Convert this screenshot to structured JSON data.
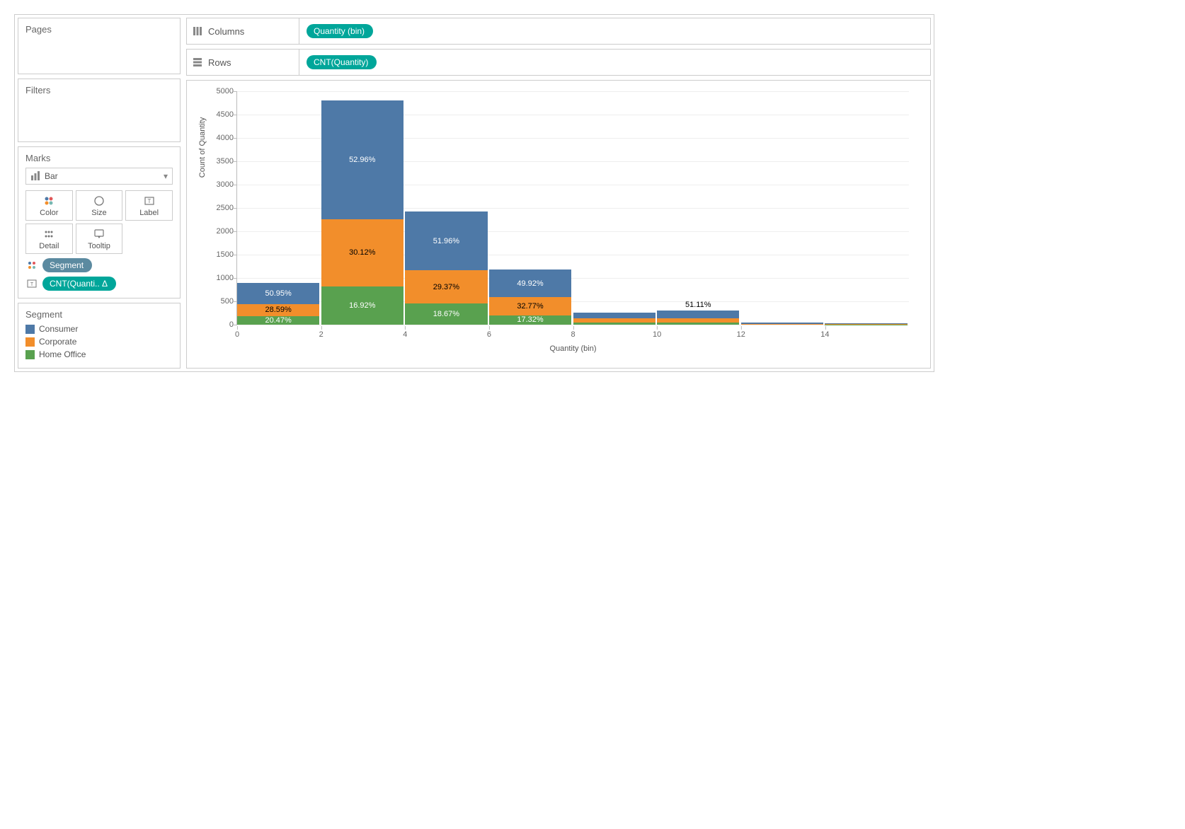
{
  "panels": {
    "pages": {
      "title": "Pages"
    },
    "filters": {
      "title": "Filters"
    },
    "marks": {
      "title": "Marks",
      "markType": "Bar",
      "buttons": {
        "color": "Color",
        "size": "Size",
        "label": "Label",
        "detail": "Detail",
        "tooltip": "Tooltip"
      },
      "pills": [
        {
          "icon": "color",
          "label": "Segment",
          "style": "steel"
        },
        {
          "icon": "label",
          "label": "CNT(Quanti.. Δ",
          "style": "teal"
        }
      ]
    },
    "legend": {
      "title": "Segment",
      "items": [
        {
          "label": "Consumer",
          "color": "#4e79a7"
        },
        {
          "label": "Corporate",
          "color": "#f28e2b"
        },
        {
          "label": "Home Office",
          "color": "#59a14f"
        }
      ]
    }
  },
  "shelves": {
    "columns": {
      "label": "Columns",
      "pill": "Quantity (bin)"
    },
    "rows": {
      "label": "Rows",
      "pill": "CNT(Quantity)"
    }
  },
  "chart_data": {
    "type": "bar",
    "stacked": true,
    "xlabel": "Quantity (bin)",
    "ylabel": "Count of Quantity",
    "ylim": [
      0,
      5000
    ],
    "yticks": [
      0,
      500,
      1000,
      1500,
      2000,
      2500,
      3000,
      3500,
      4000,
      4500,
      5000
    ],
    "categories": [
      0,
      2,
      4,
      6,
      8,
      10,
      12,
      14
    ],
    "colors": {
      "Consumer": "#4e79a7",
      "Corporate": "#f28e2b",
      "Home Office": "#59a14f"
    },
    "series": [
      {
        "name": "Home Office",
        "values": [
          184,
          814,
          451,
          204,
          40,
          50,
          8,
          5
        ]
      },
      {
        "name": "Corporate",
        "values": [
          257,
          1449,
          710,
          386,
          90,
          90,
          12,
          8
        ]
      },
      {
        "name": "Consumer",
        "values": [
          459,
          2547,
          1256,
          588,
          130,
          160,
          20,
          12
        ]
      }
    ],
    "labels": [
      {
        "bin": 0,
        "seg": "Home Office",
        "text": "20.47%",
        "color": "white"
      },
      {
        "bin": 0,
        "seg": "Corporate",
        "text": "28.59%",
        "color": "black"
      },
      {
        "bin": 0,
        "seg": "Consumer",
        "text": "50.95%",
        "color": "white"
      },
      {
        "bin": 2,
        "seg": "Home Office",
        "text": "16.92%",
        "color": "white"
      },
      {
        "bin": 2,
        "seg": "Corporate",
        "text": "30.12%",
        "color": "black"
      },
      {
        "bin": 2,
        "seg": "Consumer",
        "text": "52.96%",
        "color": "white"
      },
      {
        "bin": 4,
        "seg": "Home Office",
        "text": "18.67%",
        "color": "white"
      },
      {
        "bin": 4,
        "seg": "Corporate",
        "text": "29.37%",
        "color": "black"
      },
      {
        "bin": 4,
        "seg": "Consumer",
        "text": "51.96%",
        "color": "white"
      },
      {
        "bin": 6,
        "seg": "Home Office",
        "text": "17.32%",
        "color": "white"
      },
      {
        "bin": 6,
        "seg": "Corporate",
        "text": "32.77%",
        "color": "black"
      },
      {
        "bin": 6,
        "seg": "Consumer",
        "text": "49.92%",
        "color": "white"
      },
      {
        "bin": 10,
        "seg": "Consumer",
        "text": "51.11%",
        "color": "black",
        "outside": true
      }
    ]
  }
}
